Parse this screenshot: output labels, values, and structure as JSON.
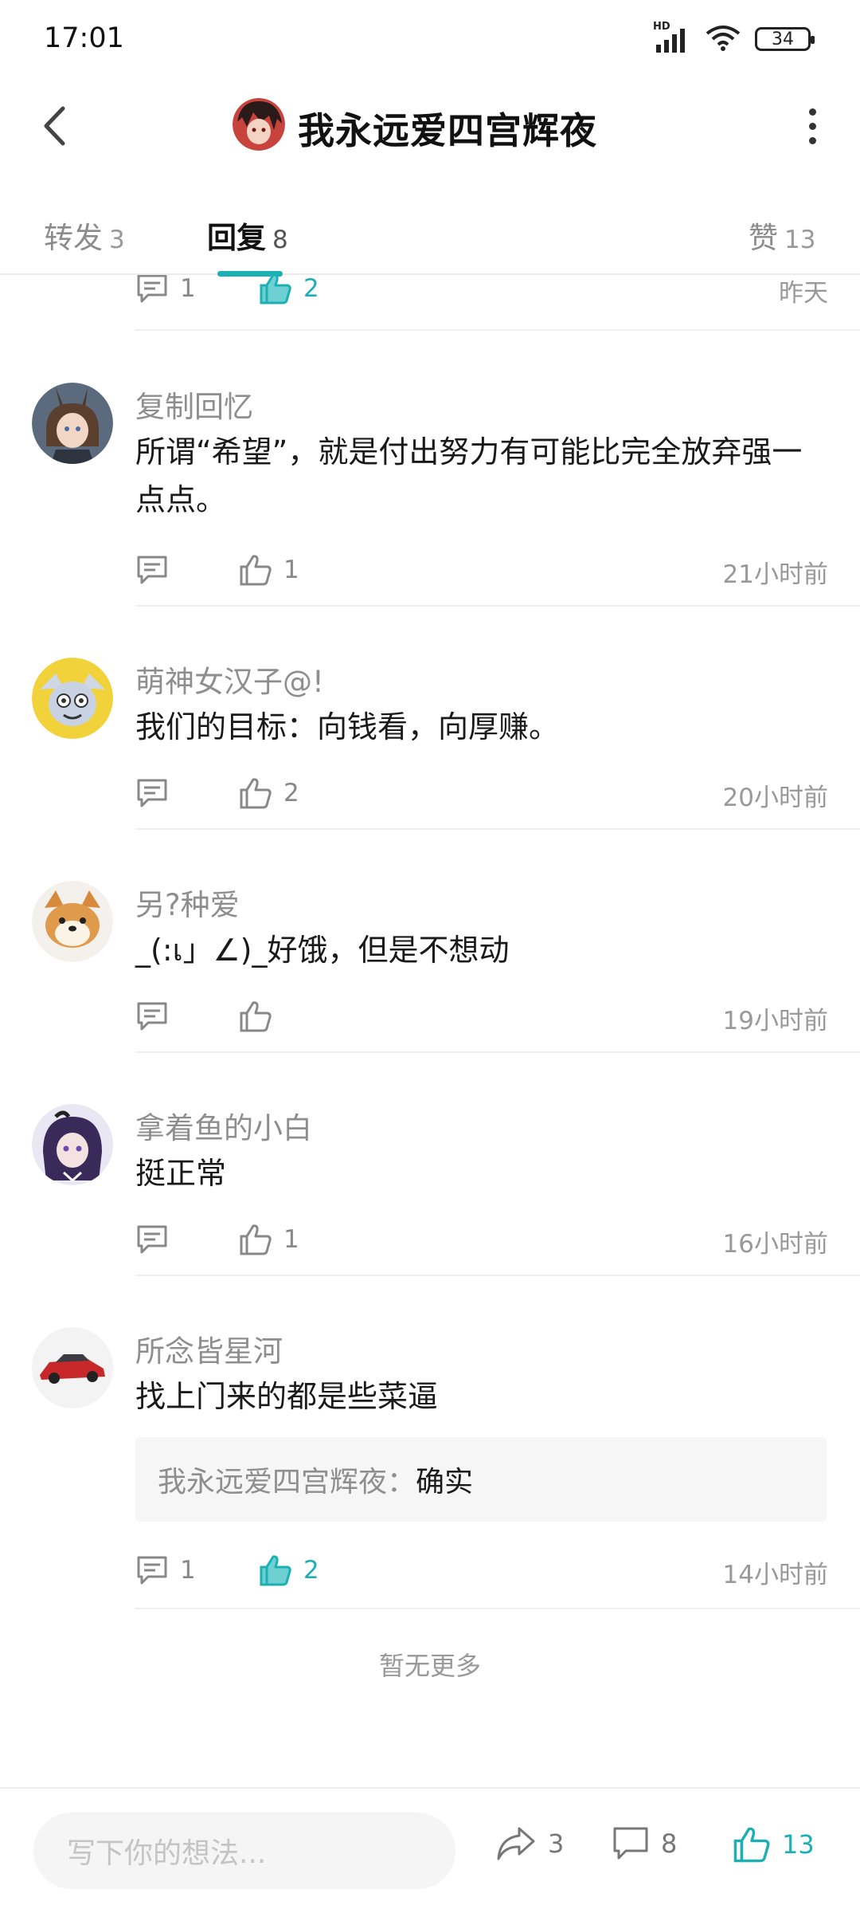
{
  "status_bar": {
    "time": "17:01",
    "hd": "HD",
    "battery": "34"
  },
  "header": {
    "title": "我永远爱四宫辉夜"
  },
  "tabs": [
    {
      "label": "转发",
      "count": "3"
    },
    {
      "label": "回复",
      "count": "8"
    },
    {
      "label": "赞",
      "count": "13"
    }
  ],
  "top_row": {
    "reply_count": "1",
    "like_count": "2",
    "time": "昨天"
  },
  "comments": [
    {
      "name": "复制回忆",
      "text_line1": "所谓“希望”，就是付出努力有可能比完全放弃强一",
      "text_line2": "点点。",
      "like_count": "1",
      "time": "21小时前"
    },
    {
      "name": "萌神女汉子@!",
      "text_line1": "我们的目标：向钱看，向厚赚。",
      "like_count": "2",
      "time": "20小时前"
    },
    {
      "name": "另?种爱",
      "text_line1": "_(:เ」∠)_好饿，但是不想动",
      "like_count": "",
      "time": "19小时前"
    },
    {
      "name": "拿着鱼的小白",
      "text_line1": "挺正常",
      "like_count": "1",
      "time": "16小时前"
    },
    {
      "name": "所念皆星河",
      "text_line1": "找上门来的都是些菜逼",
      "quote_name": "我永远爱四宫辉夜：",
      "quote_text": "确实",
      "reply_count": "1",
      "like_count": "2",
      "time": "14小时前"
    }
  ],
  "no_more": "暂无更多",
  "bottom_bar": {
    "placeholder": "写下你的想法...",
    "repost_count": "3",
    "comment_count": "8",
    "like_count": "13"
  },
  "colors": {
    "accent": "#1cb0b5",
    "muted_text": "#999999",
    "divider": "#f0f0f0"
  }
}
